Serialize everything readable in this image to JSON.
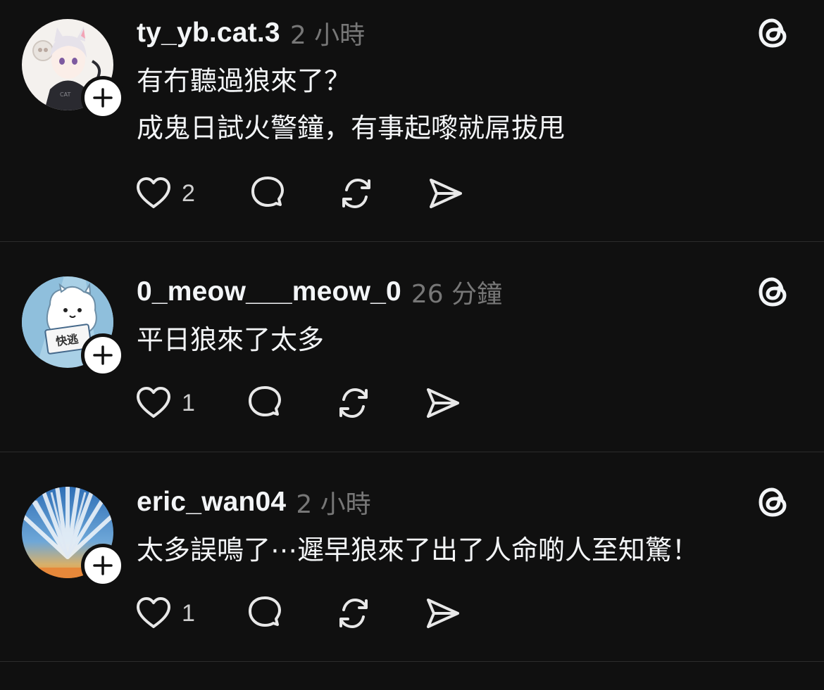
{
  "posts": [
    {
      "username": "ty_yb.cat.3",
      "time": "2 小時",
      "lines": [
        "有冇聽過狼來了？",
        "成鬼日試火警鐘，有事起嚟就屌拔甩"
      ],
      "like_count": "2",
      "avatar": "anime-catgirl-avatar"
    },
    {
      "username": "0_meow___meow_0",
      "time": "26 分鐘",
      "lines": [
        "平日狼來了太多"
      ],
      "like_count": "1",
      "avatar": "cartoon-character-avatar",
      "avatar_sign_text": "快逃"
    },
    {
      "username": "eric_wan04",
      "time": "2 小時",
      "lines": [
        "太多誤鳴了⋯遲早狼來了出了人命啲人至知驚！"
      ],
      "like_count": "1",
      "avatar": "sky-clouds-avatar"
    }
  ],
  "icons": {
    "follow": "plus-icon",
    "threads": "threads-logo-icon",
    "like": "heart-icon",
    "reply": "comment-icon",
    "repost": "repost-icon",
    "share": "send-icon"
  },
  "colors": {
    "background": "#101010",
    "text": "#f3f5f7",
    "secondary": "#777777",
    "divider": "#2c2c2c"
  }
}
